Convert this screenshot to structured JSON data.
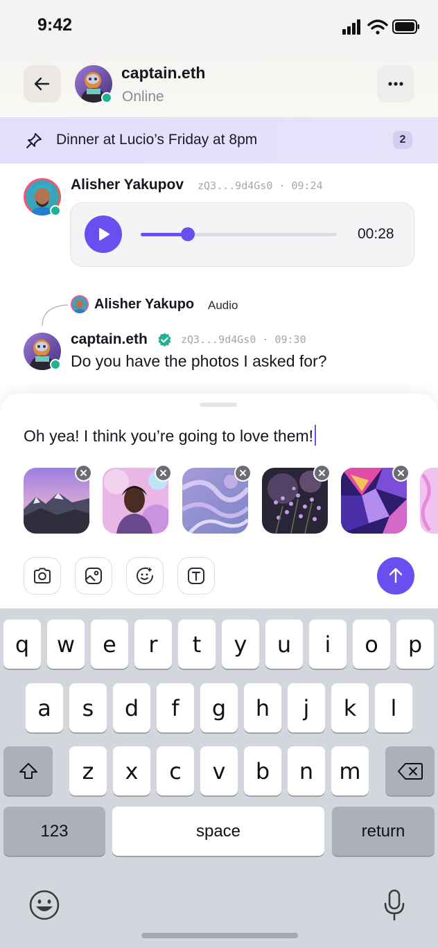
{
  "status_bar": {
    "time": "9:42"
  },
  "header": {
    "name": "captain.eth",
    "status": "Online",
    "back_icon": "arrow-left-icon",
    "more_icon": "more-horizontal-icon"
  },
  "pinned": {
    "text": "Dinner at Lucio’s Friday at 8pm",
    "count": "2",
    "icon": "pin-icon"
  },
  "messages": [
    {
      "sender": "Alisher Yakupov",
      "meta": "zQ3...9d4Gs0 · 09:24",
      "type": "audio",
      "audio_duration": "00:28",
      "audio_progress": 0.24
    },
    {
      "reply_to_name": "Alisher Yakupo",
      "reply_to_type": "Audio",
      "sender": "captain.eth",
      "verified": true,
      "meta": "zQ3...9d4Gs0 · 09:30",
      "text": "Do you have the photos I asked for?"
    }
  ],
  "composer": {
    "text": "Oh yea! I think you’re going to love them!",
    "tools": [
      "camera-icon",
      "image-icon",
      "sticker-icon",
      "text-format-icon"
    ],
    "send_icon": "arrow-up-icon"
  },
  "keyboard": {
    "row1": [
      "q",
      "w",
      "e",
      "r",
      "t",
      "y",
      "u",
      "i",
      "o",
      "p"
    ],
    "row2": [
      "a",
      "s",
      "d",
      "f",
      "g",
      "h",
      "j",
      "k",
      "l"
    ],
    "row3": [
      "z",
      "x",
      "c",
      "v",
      "b",
      "n",
      "m"
    ],
    "numbers_label": "123",
    "space_label": "space",
    "return_label": "return"
  },
  "colors": {
    "accent": "#6b4ef0",
    "online": "#20b195",
    "pinned_bg": "#e3defc"
  }
}
